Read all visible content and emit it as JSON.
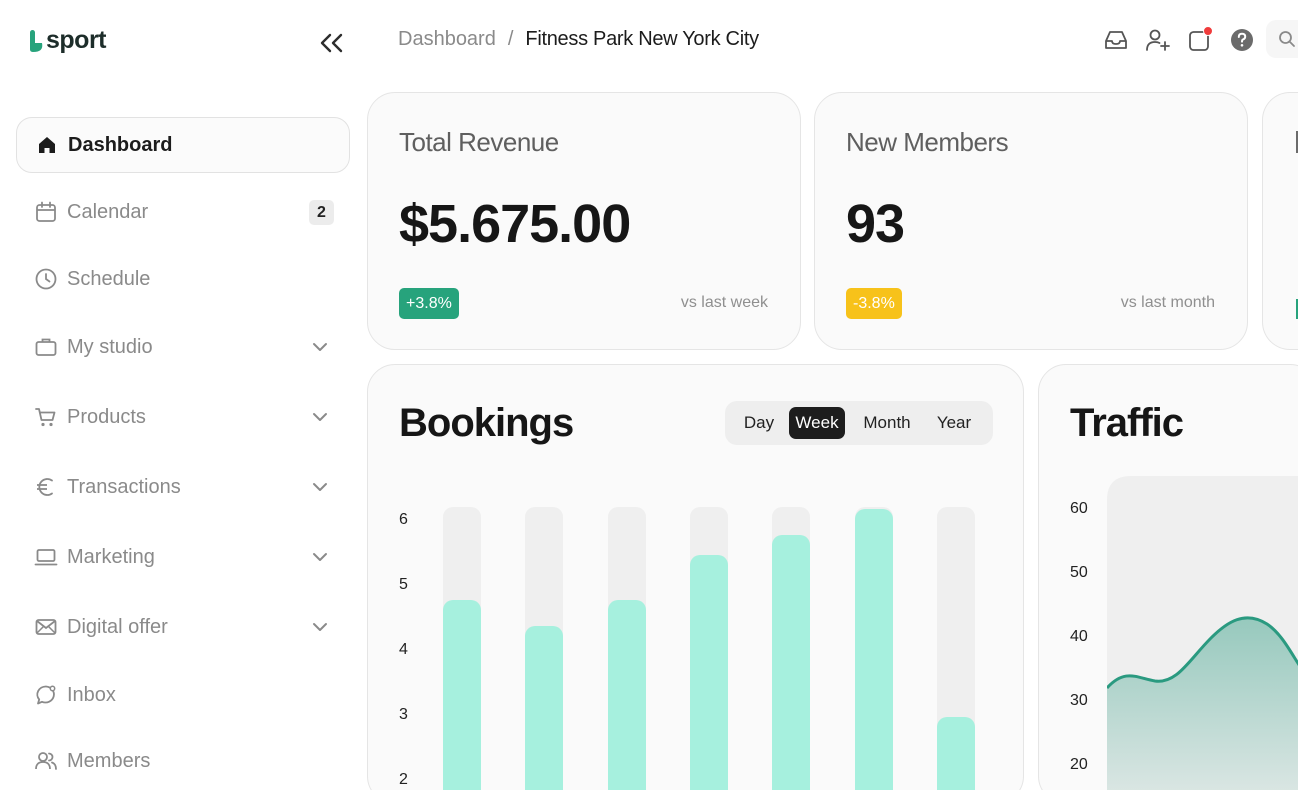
{
  "brand": {
    "logo_text": "sport",
    "accent": "#27a37c"
  },
  "sidebar": {
    "items": [
      {
        "label": "Dashboard",
        "icon": "home-icon",
        "active": true
      },
      {
        "label": "Calendar",
        "icon": "calendar-icon",
        "badge": "2"
      },
      {
        "label": "Schedule",
        "icon": "clock-icon"
      },
      {
        "label": "My studio",
        "icon": "briefcase-icon",
        "expandable": true
      },
      {
        "label": "Products",
        "icon": "cart-icon",
        "expandable": true
      },
      {
        "label": "Transactions",
        "icon": "euro-icon",
        "expandable": true
      },
      {
        "label": "Marketing",
        "icon": "laptop-icon",
        "expandable": true
      },
      {
        "label": "Digital offer",
        "icon": "envelope-icon",
        "expandable": true
      },
      {
        "label": "Inbox",
        "icon": "chat-icon"
      },
      {
        "label": "Members",
        "icon": "users-icon"
      }
    ]
  },
  "header": {
    "breadcrumb_root": "Dashboard",
    "breadcrumb_sep": "/",
    "breadcrumb_current": "Fitness Park New York City"
  },
  "stats": [
    {
      "title": "Total Revenue",
      "value": "$5.675.00",
      "change": "+3.8%",
      "change_color": "#27a37c",
      "comparison": "vs last week"
    },
    {
      "title": "New Members",
      "value": "93",
      "change": "-3.8%",
      "change_color": "#f7c21a",
      "comparison": "vs last month"
    }
  ],
  "bookings": {
    "title": "Bookings",
    "periods": [
      "Day",
      "Week",
      "Month",
      "Year"
    ],
    "active_period": "Week",
    "chart_data": {
      "type": "bar",
      "title": "Bookings",
      "yticks": [
        "6",
        "5",
        "4",
        "3",
        "2"
      ],
      "values": [
        4.6,
        4.2,
        4.6,
        5.3,
        5.6,
        6.0,
        2.8
      ],
      "max": 6,
      "colors": {
        "fill": "#a6f0de",
        "track": "#efefef"
      }
    }
  },
  "traffic": {
    "title": "Traffic",
    "chart_data": {
      "type": "area",
      "title": "Traffic",
      "yticks": [
        "60",
        "50",
        "40",
        "30",
        "20"
      ],
      "color": "#2a9a80"
    }
  }
}
